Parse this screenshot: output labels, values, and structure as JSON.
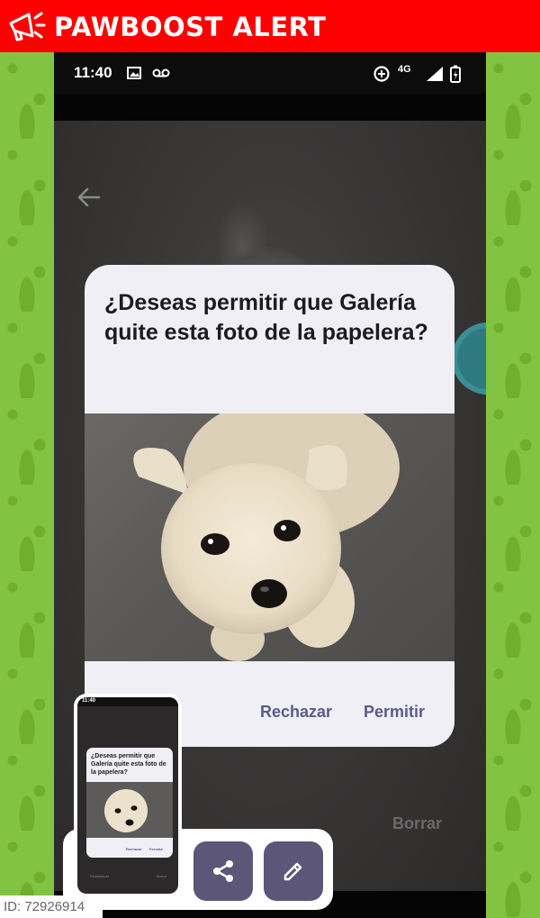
{
  "alert": {
    "title": "PAWBOOST ALERT",
    "color": "#fe0000"
  },
  "status_bar": {
    "time": "11:40",
    "network": "4G"
  },
  "dialog": {
    "title": "¿Deseas permitir que Galería quite esta foto de la papelera?",
    "buttons": {
      "reject": "Rechazar",
      "allow": "Permitir"
    }
  },
  "background_bottom": {
    "left_partial": "r",
    "right": "Borrar"
  },
  "thumbnail": {
    "time": "11:40",
    "title": "¿Deseas permitir que Galería quite esta foto de la papelera?",
    "reject": "Rechazar",
    "allow": "Permitir",
    "bottom_left": "Restablecer",
    "bottom_right": "Borrar"
  },
  "actions": {
    "share_icon": "share-icon",
    "edit_icon": "pencil-icon"
  },
  "footer": {
    "id_label": "ID: 72926914"
  },
  "colors": {
    "accent_text": "#5b5a8a",
    "dialog_bg": "#f1eff6",
    "action_button": "#5c5778",
    "side_pattern": "#82c441"
  }
}
